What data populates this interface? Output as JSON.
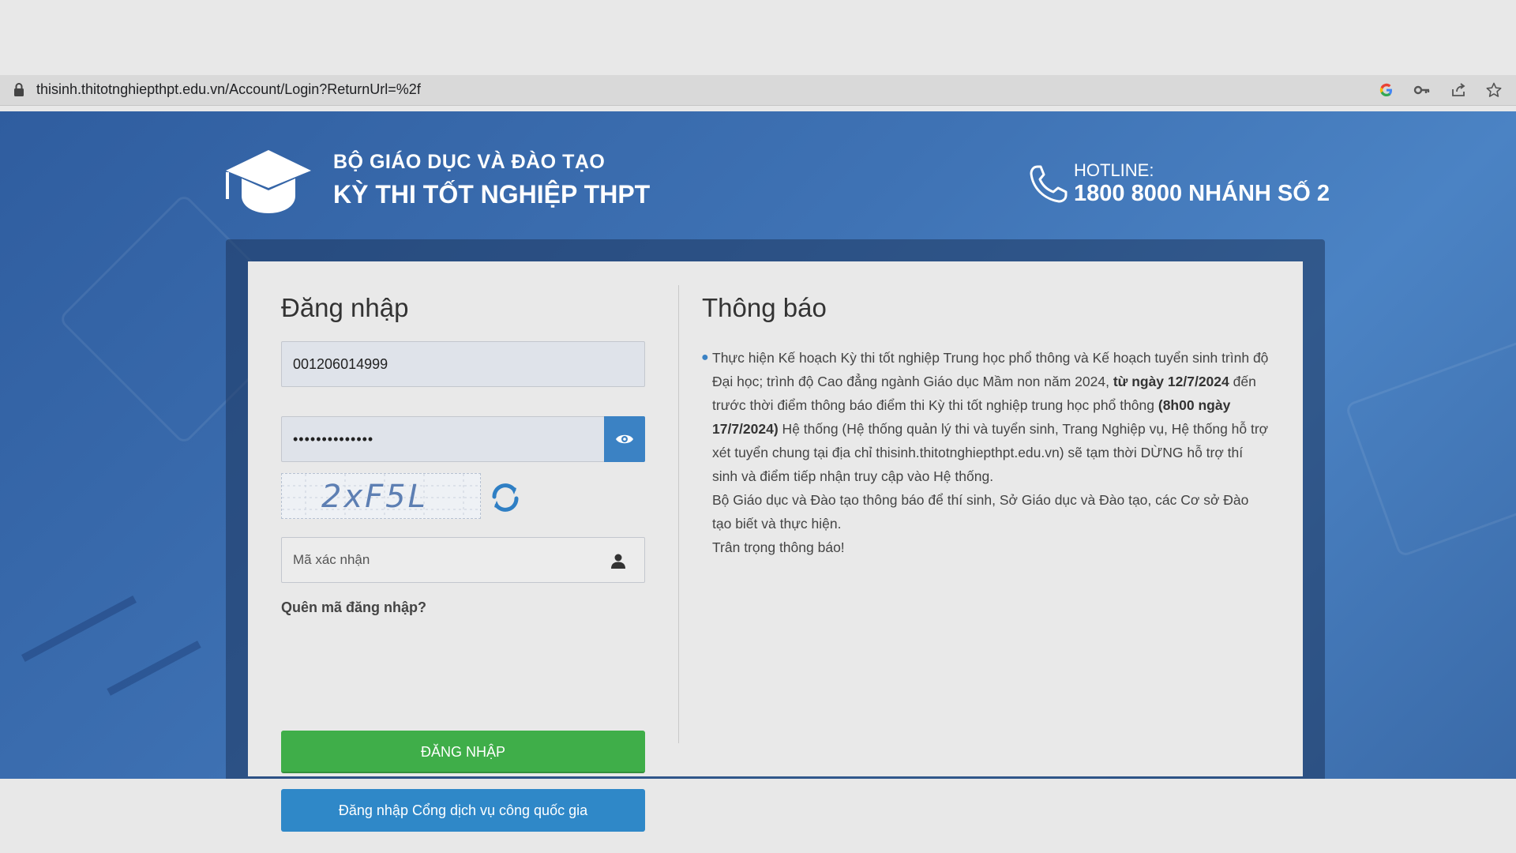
{
  "browser": {
    "url": "thisinh.thitotnghiepthpt.edu.vn/Account/Login?ReturnUrl=%2f",
    "icons": [
      "lock-icon",
      "google-icon",
      "key-icon",
      "share-icon",
      "star-icon"
    ]
  },
  "header": {
    "ministry": "BỘ GIÁO DỤC VÀ ĐÀO TẠO",
    "exam": "KỲ THI TỐT NGHIỆP THPT",
    "hotline_label": "HOTLINE:",
    "hotline_number": "1800 8000 NHÁNH SỐ 2"
  },
  "login": {
    "title": "Đăng nhập",
    "username_value": "001206014999",
    "password_value": "••••••••••••••",
    "captcha_text": "2xF5L",
    "code_placeholder": "Mã xác nhận",
    "forgot_label": "Quên mã đăng nhập?",
    "login_button": "ĐĂNG NHẬP",
    "gov_button": "Đăng nhập Cổng dịch vụ công quốc gia"
  },
  "notice": {
    "title": "Thông báo",
    "p1_a": "Thực hiện Kế hoạch Kỳ thi tốt nghiệp Trung học phổ thông và Kế hoạch tuyển sinh trình độ Đại học; trình độ Cao đẳng ngành Giáo dục Mầm non năm 2024, ",
    "p1_b": "từ ngày 12/7/2024",
    "p1_c": " đến trước thời điểm thông báo điểm thi Kỳ thi tốt nghiệp trung học phổ thông ",
    "p1_d": "(8h00 ngày 17/7/2024)",
    "p1_e": " Hệ thống (Hệ thống quản lý thi và tuyển sinh, Trang Nghiệp vụ, Hệ thống hỗ trợ xét tuyển chung tại địa chỉ thisinh.thitotnghiepthpt.edu.vn) sẽ tạm thời DỪNG hỗ trợ thí sinh và điểm tiếp nhận truy cập vào Hệ thống.",
    "p2": "Bộ Giáo dục và Đào tạo thông báo để thí sinh, Sở Giáo dục và Đào tạo, các Cơ sở Đào tạo biết và thực hiện.",
    "p3": "Trân trọng thông báo!"
  },
  "colors": {
    "banner": "#3f73b5",
    "login_button": "#3fae49",
    "gov_button": "#2f88c8",
    "eye_button": "#3b82c4"
  }
}
